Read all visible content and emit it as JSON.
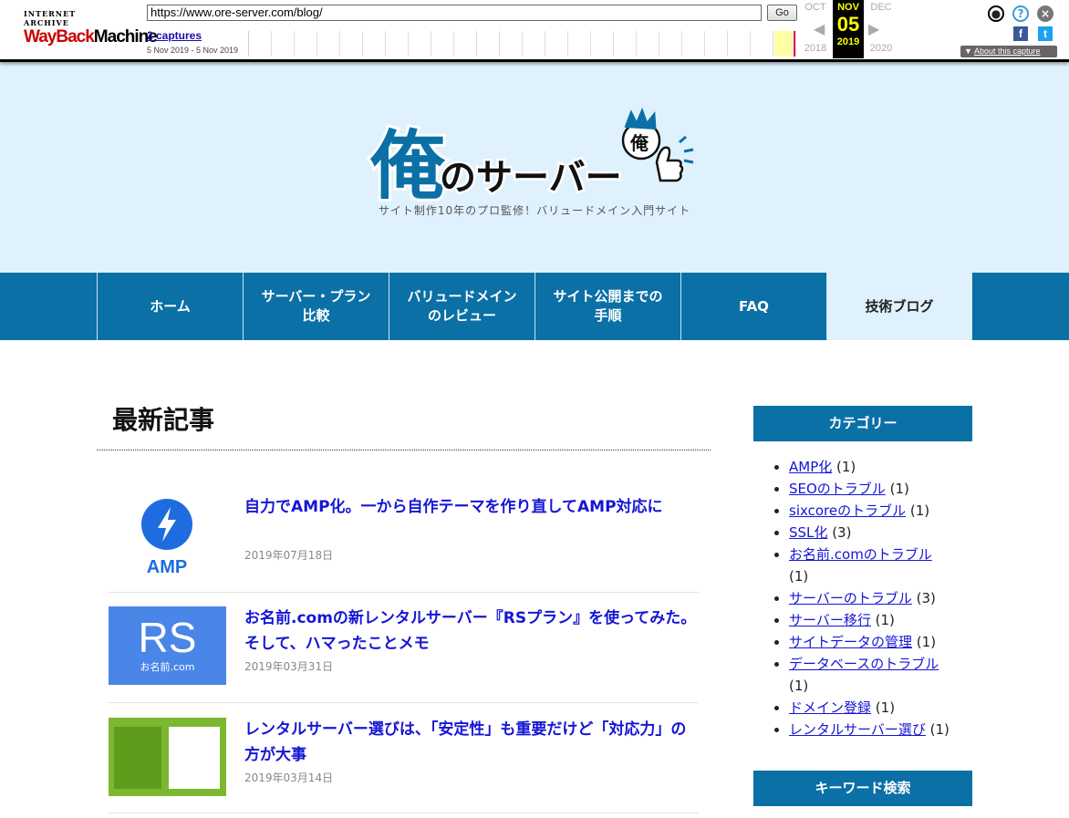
{
  "wayback": {
    "logo_top": "INTERNET ARCHIVE",
    "logo_wayback": "WayBack",
    "logo_machine": "Machine",
    "url": "https://www.ore-server.com/blog/",
    "go": "Go",
    "captures": "2 captures",
    "capture_range": "5 Nov 2019 - 5 Nov 2019",
    "prev_month": "OCT",
    "cur_month": "NOV",
    "cur_day": "05",
    "next_month": "DEC",
    "prev_year": "2018",
    "cur_year": "2019",
    "next_year": "2020",
    "about": "About this capture",
    "about_arrow": "▼",
    "fb": "f",
    "tw": "t"
  },
  "header": {
    "logo_kanji": "俺",
    "logo_text": "のサーバー",
    "badge": "俺",
    "tagline": "サイト制作10年のプロ監修！バリュードメイン入門サイト"
  },
  "nav": {
    "items": [
      {
        "label": "ホーム"
      },
      {
        "label": "サーバー・プラン\n比較"
      },
      {
        "label": "バリュードメイン\nのレビュー"
      },
      {
        "label": "サイト公開までの\n手順"
      },
      {
        "label": "FAQ"
      },
      {
        "label": "技術ブログ"
      }
    ]
  },
  "main": {
    "title": "最新記事",
    "posts": [
      {
        "title": "自力でAMP化。一から自作テーマを作り直してAMP対応に",
        "date": "2019年07月18日",
        "thumb_label": "AMP"
      },
      {
        "title": "お名前.comの新レンタルサーバー『RSプラン』を使ってみた。そして、ハマったことメモ",
        "date": "2019年03月31日",
        "thumb_label": "RS",
        "thumb_sub": "お名前.com"
      },
      {
        "title": "レンタルサーバー選びは、「安定性」も重要だけど「対応力」の方が大事",
        "date": "2019年03月14日"
      }
    ]
  },
  "sidebar": {
    "categories_heading": "カテゴリー",
    "categories": [
      {
        "name": "AMP化",
        "count": "(1)"
      },
      {
        "name": "SEOのトラブル",
        "count": "(1)"
      },
      {
        "name": "sixcoreのトラブル",
        "count": "(1)"
      },
      {
        "name": "SSL化",
        "count": "(3)"
      },
      {
        "name": "お名前.comのトラブル",
        "count": "(1)"
      },
      {
        "name": "サーバーのトラブル",
        "count": "(3)"
      },
      {
        "name": "サーバー移行",
        "count": "(1)"
      },
      {
        "name": "サイトデータの管理",
        "count": "(1)"
      },
      {
        "name": "データベースのトラブル",
        "count": "(1)"
      },
      {
        "name": "ドメイン登録",
        "count": "(1)"
      },
      {
        "name": "レンタルサーバー選び",
        "count": "(1)"
      }
    ],
    "keyword_heading": "キーワード検索"
  },
  "colors": {
    "nav_bg": "#0b70a5",
    "header_bg": "#dff1fc",
    "link": "#1515d6"
  }
}
